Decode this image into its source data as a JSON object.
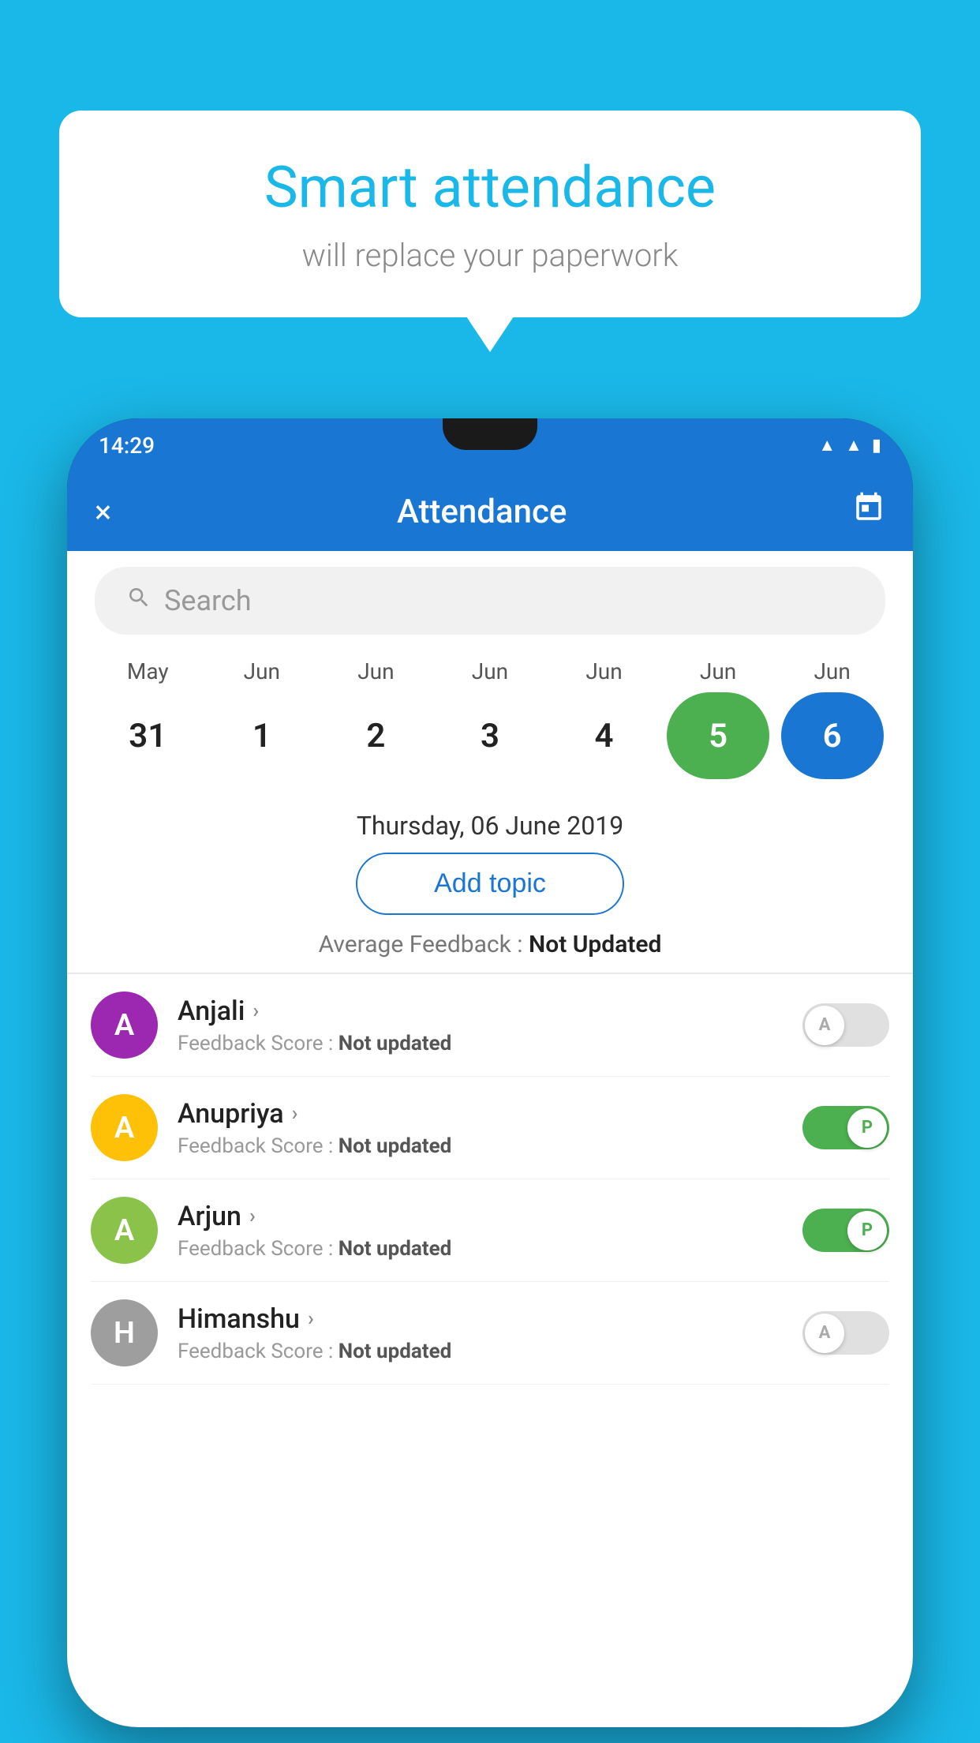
{
  "background_color": "#1ab8e8",
  "speech_bubble": {
    "title": "Smart attendance",
    "subtitle": "will replace your paperwork"
  },
  "status_bar": {
    "time": "14:29",
    "icons": [
      "wifi",
      "signal",
      "battery"
    ]
  },
  "app_bar": {
    "title": "Attendance",
    "close_label": "×",
    "calendar_icon": "📅"
  },
  "search": {
    "placeholder": "Search"
  },
  "calendar": {
    "months": [
      "May",
      "Jun",
      "Jun",
      "Jun",
      "Jun",
      "Jun",
      "Jun"
    ],
    "dates": [
      "31",
      "1",
      "2",
      "3",
      "4",
      "5",
      "6"
    ],
    "today_index": 5,
    "selected_index": 6
  },
  "selected_date_label": "Thursday, 06 June 2019",
  "add_topic_button": "Add topic",
  "avg_feedback_label": "Average Feedback : ",
  "avg_feedback_value": "Not Updated",
  "students": [
    {
      "name": "Anjali",
      "avatar_letter": "A",
      "avatar_color": "#9c27b0",
      "score_label": "Feedback Score : ",
      "score_value": "Not updated",
      "status": "absent"
    },
    {
      "name": "Anupriya",
      "avatar_letter": "A",
      "avatar_color": "#ffc107",
      "score_label": "Feedback Score : ",
      "score_value": "Not updated",
      "status": "present"
    },
    {
      "name": "Arjun",
      "avatar_letter": "A",
      "avatar_color": "#8bc34a",
      "score_label": "Feedback Score : ",
      "score_value": "Not updated",
      "status": "present"
    },
    {
      "name": "Himanshu",
      "avatar_letter": "H",
      "avatar_color": "#9e9e9e",
      "score_label": "Feedback Score : ",
      "score_value": "Not updated",
      "status": "absent"
    }
  ]
}
